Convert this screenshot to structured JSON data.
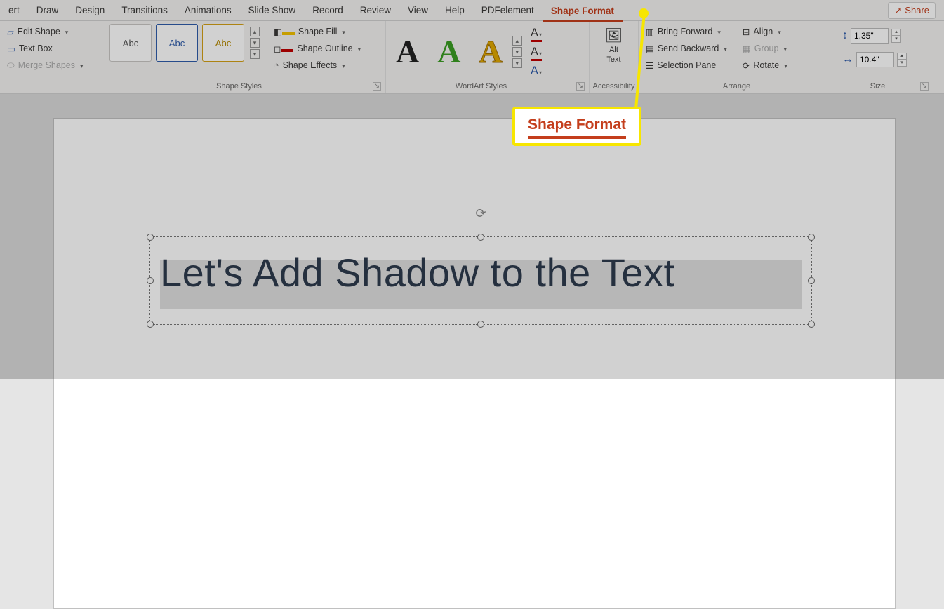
{
  "tabs": {
    "insert": "ert",
    "draw": "Draw",
    "design": "Design",
    "transitions": "Transitions",
    "animations": "Animations",
    "slideshow": "Slide Show",
    "record": "Record",
    "review": "Review",
    "view": "View",
    "help": "Help",
    "pdfelement": "PDFelement",
    "shape_format": "Shape Format"
  },
  "share": "Share",
  "insert_shapes": {
    "edit_shape": "Edit Shape",
    "text_box": "Text Box",
    "merge_shapes": "Merge Shapes"
  },
  "shape_styles": {
    "abc": "Abc",
    "fill": "Shape Fill",
    "outline": "Shape Outline",
    "effects": "Shape Effects",
    "group": "Shape Styles"
  },
  "wordart": {
    "group": "WordArt Styles"
  },
  "alt": {
    "label1": "Alt",
    "label2": "Text",
    "group": "Accessibility"
  },
  "arrange": {
    "bring_forward": "Bring Forward",
    "send_backward": "Send Backward",
    "selection_pane": "Selection Pane",
    "align": "Align",
    "group_btn": "Group",
    "rotate": "Rotate",
    "group": "Arrange"
  },
  "size": {
    "h": "1.35\"",
    "w": "10.4\"",
    "group": "Size"
  },
  "slide": {
    "text": "Let's Add Shadow to the Text"
  },
  "callout": {
    "text": "Shape Format"
  }
}
